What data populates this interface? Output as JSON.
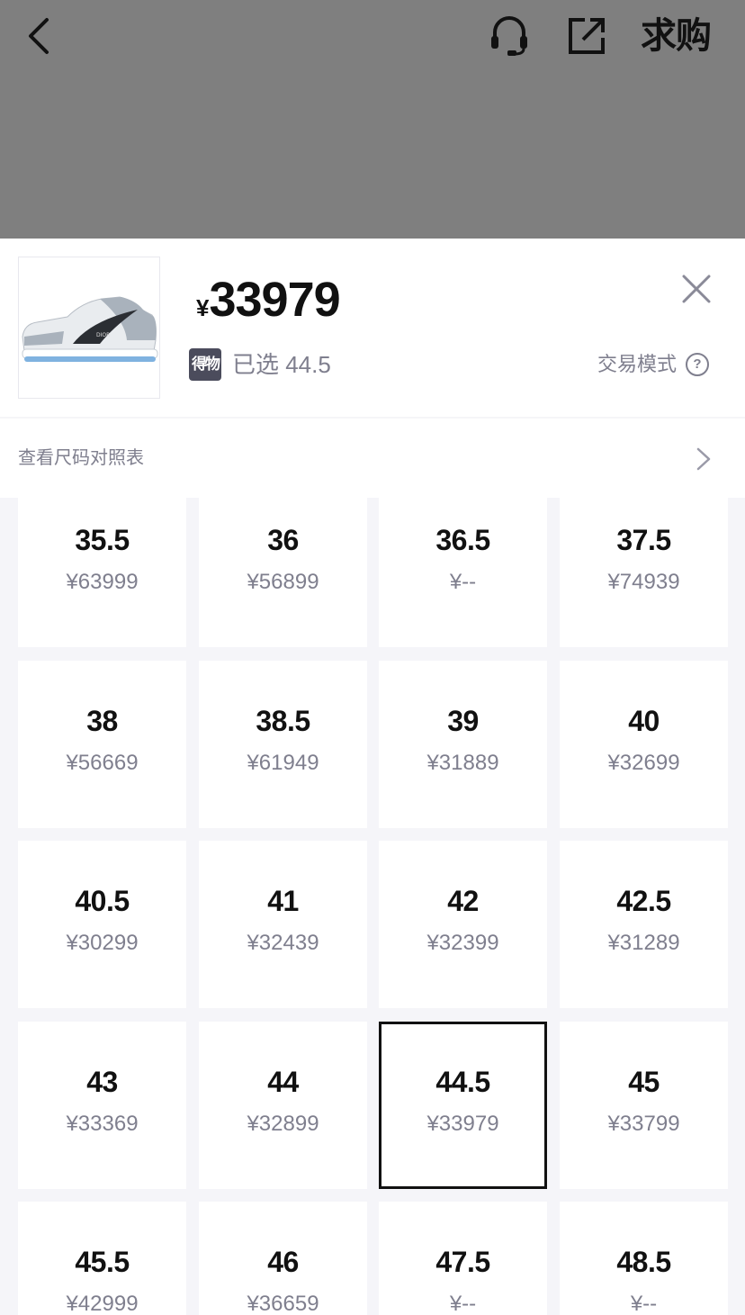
{
  "header": {
    "want_label": "求购"
  },
  "product": {
    "currency": "¥",
    "price": "33979",
    "brand_badge": "得物",
    "selected_text": "已选 44.5",
    "trade_mode_label": "交易模式",
    "size_chart_label": "查看尺码对照表"
  },
  "sizes": [
    {
      "size": "35.5",
      "price": "¥63999"
    },
    {
      "size": "36",
      "price": "¥56899"
    },
    {
      "size": "36.5",
      "price": "¥--"
    },
    {
      "size": "37.5",
      "price": "¥74939"
    },
    {
      "size": "38",
      "price": "¥56669"
    },
    {
      "size": "38.5",
      "price": "¥61949"
    },
    {
      "size": "39",
      "price": "¥31889"
    },
    {
      "size": "40",
      "price": "¥32699"
    },
    {
      "size": "40.5",
      "price": "¥30299"
    },
    {
      "size": "41",
      "price": "¥32439"
    },
    {
      "size": "42",
      "price": "¥32399"
    },
    {
      "size": "42.5",
      "price": "¥31289"
    },
    {
      "size": "43",
      "price": "¥33369"
    },
    {
      "size": "44",
      "price": "¥32899"
    },
    {
      "size": "44.5",
      "price": "¥33979",
      "selected": true
    },
    {
      "size": "45",
      "price": "¥33799"
    },
    {
      "size": "45.5",
      "price": "¥42999"
    },
    {
      "size": "46",
      "price": "¥36659"
    },
    {
      "size": "47.5",
      "price": "¥--"
    },
    {
      "size": "48.5",
      "price": "¥--"
    }
  ],
  "colors": {
    "overlay": "#7f7f7f",
    "text_primary": "#111111",
    "text_secondary": "#7f7f8e",
    "grid_bg": "#f5f5f9",
    "badge_bg": "#4b4c5c"
  }
}
